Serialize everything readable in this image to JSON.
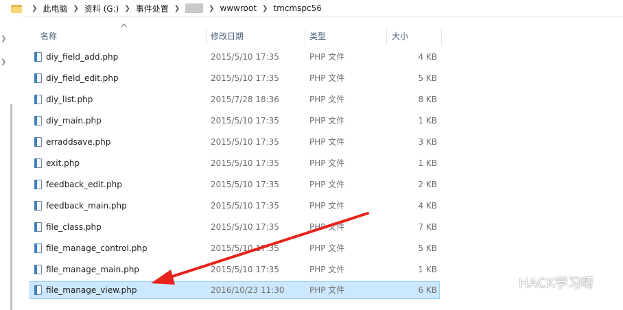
{
  "breadcrumb": {
    "items": [
      "此电脑",
      "资料 (G:)",
      "事件处置",
      "",
      "wwwroot",
      "tmcmspc56"
    ]
  },
  "columns": {
    "name": "名称",
    "date": "修改日期",
    "type": "类型",
    "size": "大小"
  },
  "files": [
    {
      "name": "diy_field_add.php",
      "date": "2015/5/10 17:35",
      "type": "PHP 文件",
      "size": "4 KB"
    },
    {
      "name": "diy_field_edit.php",
      "date": "2015/5/10 17:35",
      "type": "PHP 文件",
      "size": "5 KB"
    },
    {
      "name": "diy_list.php",
      "date": "2015/7/28 18:36",
      "type": "PHP 文件",
      "size": "8 KB"
    },
    {
      "name": "diy_main.php",
      "date": "2015/5/10 17:35",
      "type": "PHP 文件",
      "size": "1 KB"
    },
    {
      "name": "erraddsave.php",
      "date": "2015/5/10 17:35",
      "type": "PHP 文件",
      "size": "3 KB"
    },
    {
      "name": "exit.php",
      "date": "2015/5/10 17:35",
      "type": "PHP 文件",
      "size": "1 KB"
    },
    {
      "name": "feedback_edit.php",
      "date": "2015/5/10 17:35",
      "type": "PHP 文件",
      "size": "2 KB"
    },
    {
      "name": "feedback_main.php",
      "date": "2015/5/10 17:35",
      "type": "PHP 文件",
      "size": "4 KB"
    },
    {
      "name": "file_class.php",
      "date": "2015/5/10 17:35",
      "type": "PHP 文件",
      "size": "7 KB"
    },
    {
      "name": "file_manage_control.php",
      "date": "2015/5/10 17:35",
      "type": "PHP 文件",
      "size": "5 KB"
    },
    {
      "name": "file_manage_main.php",
      "date": "2015/5/10 17:35",
      "type": "PHP 文件",
      "size": "1 KB"
    },
    {
      "name": "file_manage_view.php",
      "date": "2016/10/23 11:30",
      "type": "PHP 文件",
      "size": "6 KB",
      "selected": true
    }
  ],
  "watermark": "HACK学习呀",
  "colors": {
    "selection_bg": "#cce8ff",
    "selection_border": "#99d1ff",
    "header_text": "#4c607a",
    "arrow": "#e8231b"
  },
  "icons": {
    "breadcrumb": "folder-icon",
    "file": "php-file-icon",
    "sort": "sort-up-icon",
    "watermark": "wechat-icon"
  }
}
